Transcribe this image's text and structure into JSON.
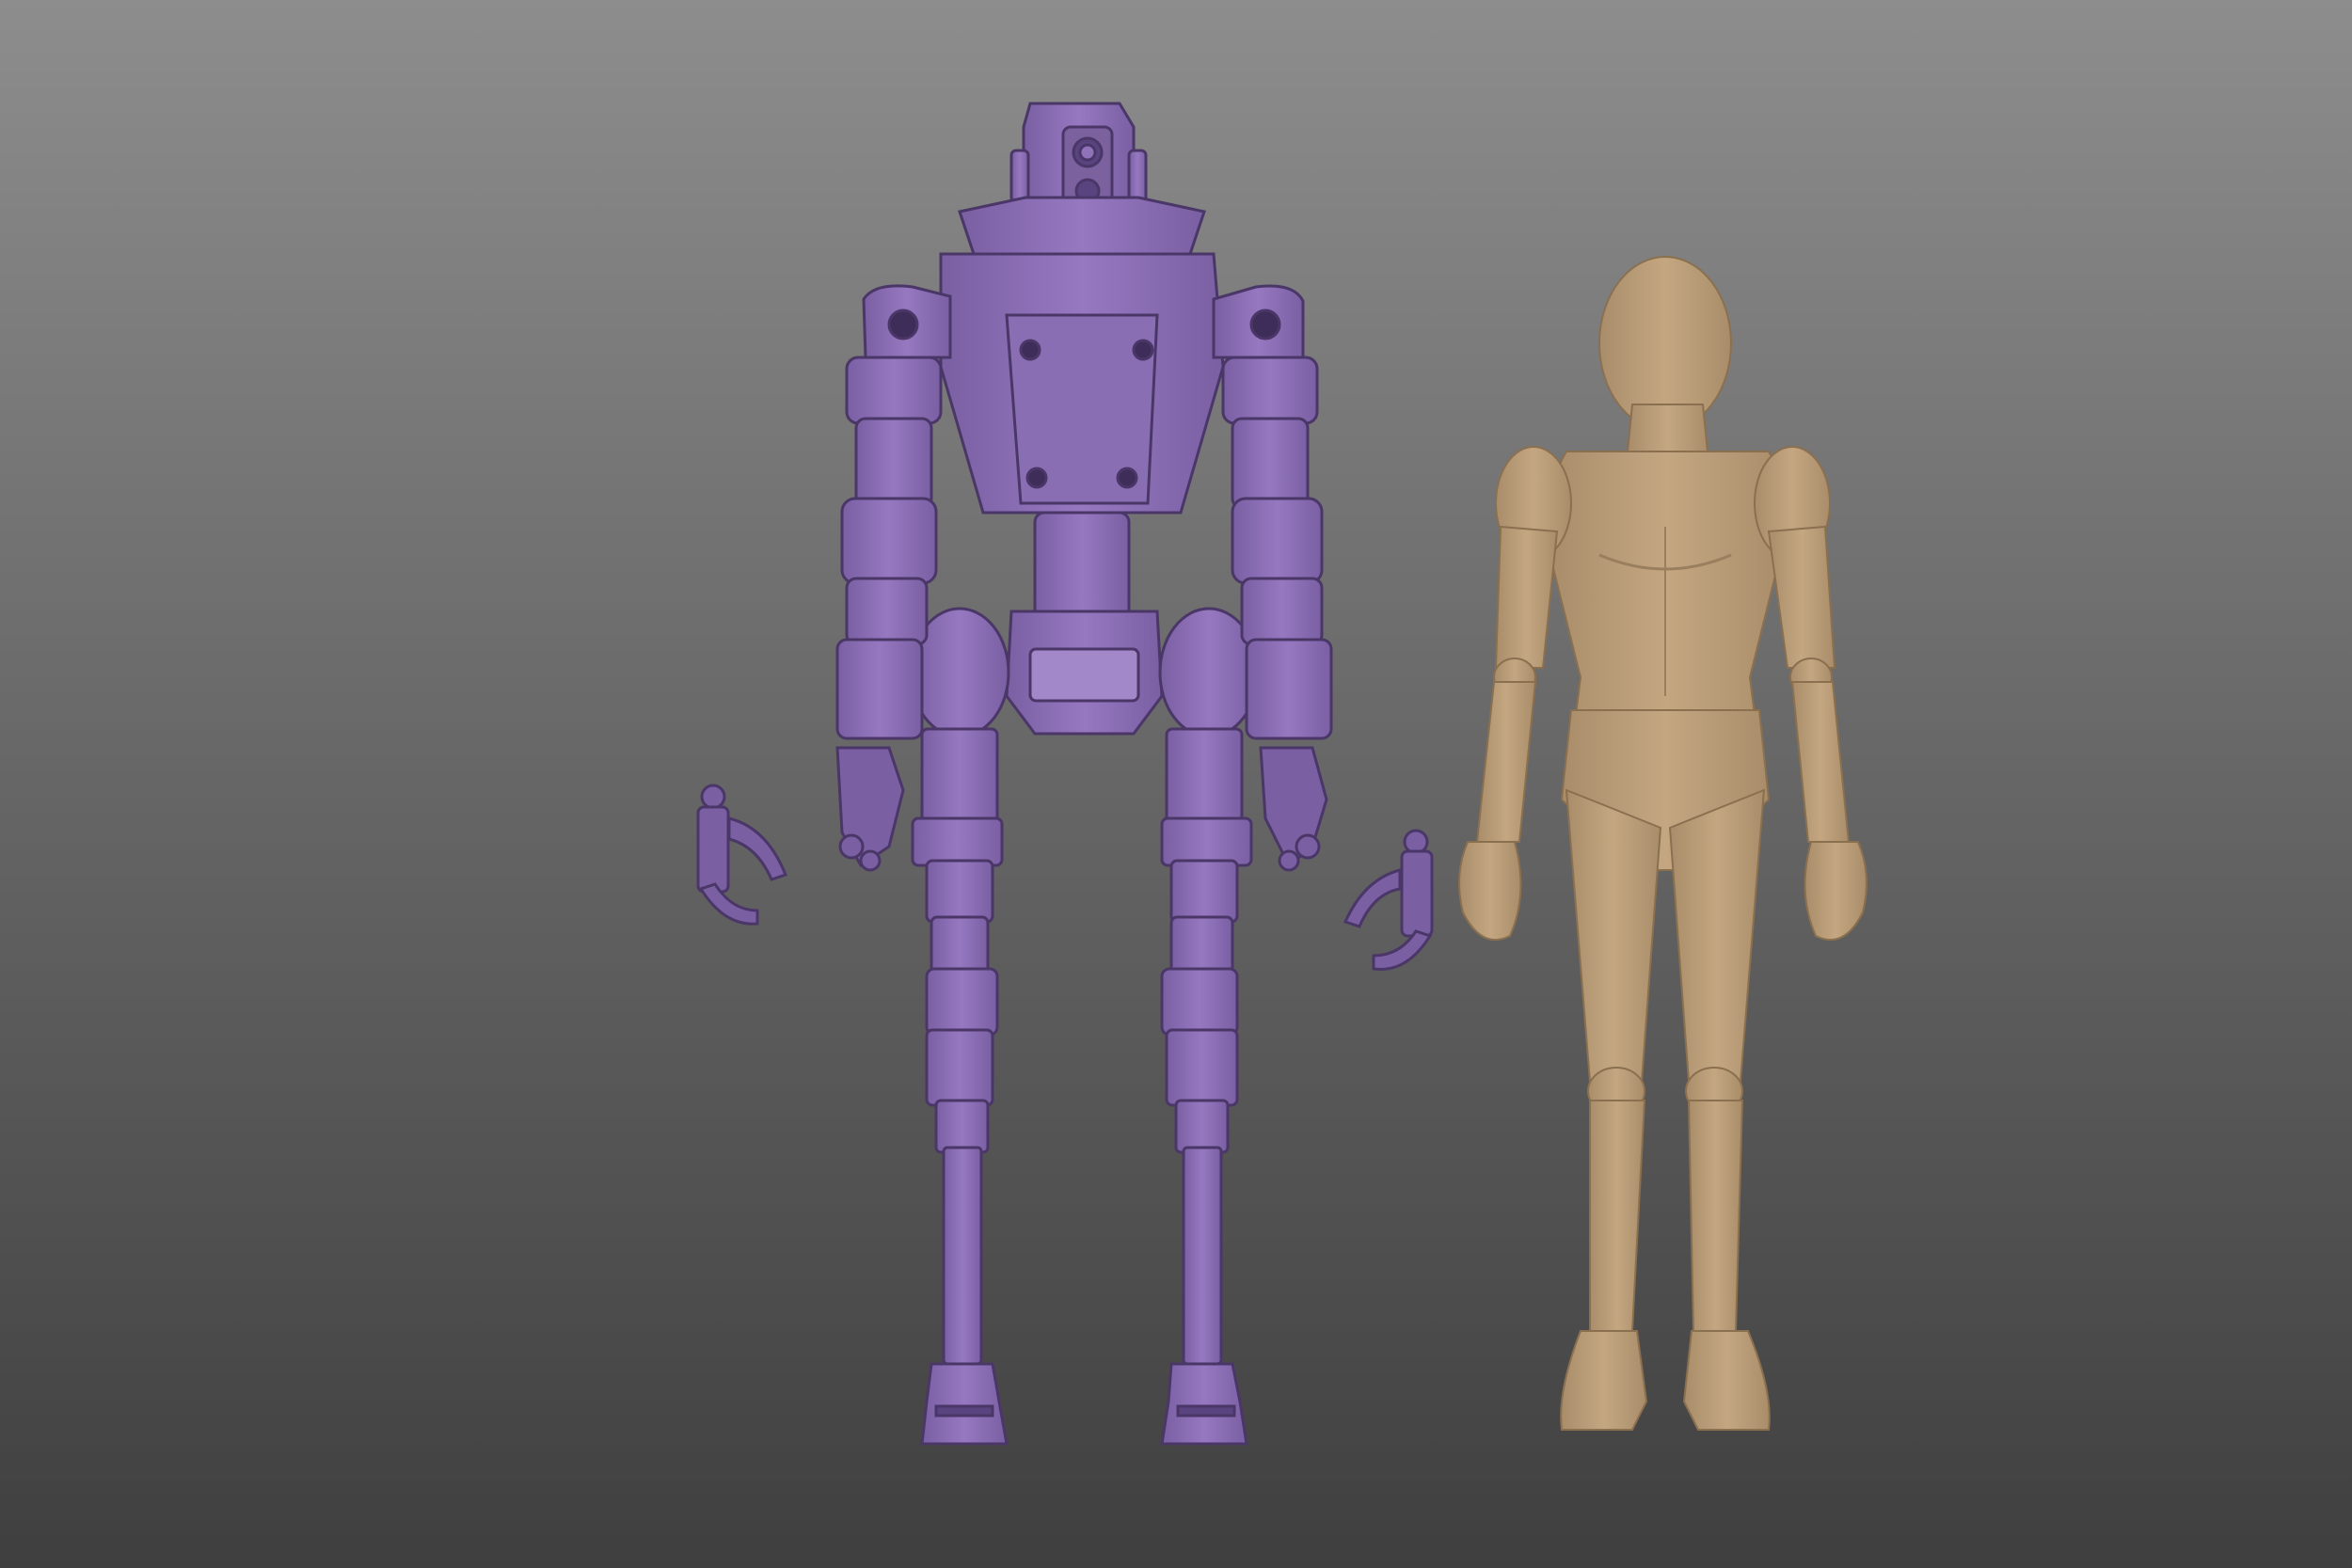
{
  "scene": {
    "background_top": "#8c8c8c",
    "background_bottom": "#3f3f3f",
    "robot_color": "#8f72b8",
    "robot_shadow": "#6a5290",
    "robot_dark": "#4a3768",
    "figure_color": "#bfa27e",
    "figure_shadow": "#9a7f5f"
  }
}
